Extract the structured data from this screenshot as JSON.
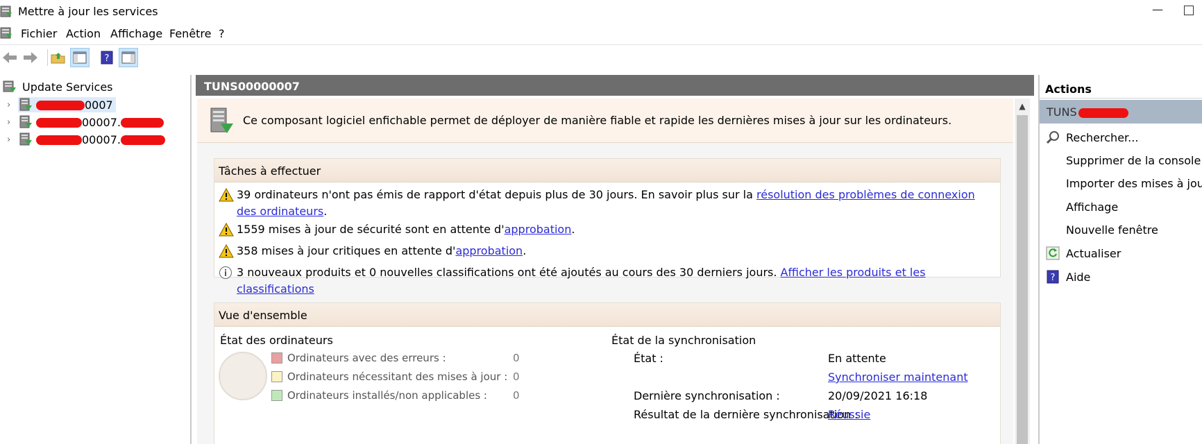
{
  "window": {
    "title": "Mettre à jour les services",
    "minimize": "—"
  },
  "menu": {
    "items": [
      "Fichier",
      "Action",
      "Affichage",
      "Fenêtre",
      "?"
    ]
  },
  "tree": {
    "root": "Update Services",
    "nodes": [
      {
        "label": "0007"
      },
      {
        "label": "00007."
      },
      {
        "label": "00007."
      }
    ]
  },
  "center": {
    "header": "TUNS00000007",
    "intro": "Ce composant logiciel enfichable permet de déployer de manière fiable et rapide les dernières mises à jour sur les ordinateurs.",
    "tasks_title": "Tâches à effectuer",
    "tasks": [
      {
        "icon": "warning-icon",
        "text": "39 ordinateurs n'ont pas émis de rapport d'état depuis plus de 30 jours. En savoir plus sur la ",
        "link": "résolution des problèmes de connexion des ordinateurs",
        "after": "."
      },
      {
        "icon": "warning-icon",
        "text": "1559 mises à jour de sécurité sont en attente d'",
        "link": "approbation",
        "after": "."
      },
      {
        "icon": "warning-icon",
        "text": "358 mises à jour critiques en attente d'",
        "link": "approbation",
        "after": "."
      },
      {
        "icon": "info-icon",
        "text": "3 nouveaux produits et 0 nouvelles classifications ont été ajoutés au cours des 30 derniers jours. ",
        "link": "Afficher les produits et les classifications",
        "after": ""
      }
    ],
    "overview_title": "Vue d'ensemble",
    "computers_title": "État des ordinateurs",
    "computer_stats": [
      {
        "label": "Ordinateurs avec des erreurs :",
        "count": "0",
        "color": "#e9a0a0"
      },
      {
        "label": "Ordinateurs nécessitant des mises à jour :",
        "count": "0",
        "color": "#fbf3c4"
      },
      {
        "label": "Ordinateurs installés/non applicables :",
        "count": "0",
        "color": "#bfe8b9"
      }
    ],
    "sync_title": "État de la synchronisation",
    "sync": {
      "state_label": "État :",
      "state_value": "En attente",
      "sync_now": "Synchroniser maintenant",
      "last_label": "Dernière synchronisation :",
      "last_value": "20/09/2021 16:18",
      "result_label": "Résultat de la dernière synchronisation :",
      "result_value": "Réussie"
    }
  },
  "actions": {
    "title": "Actions",
    "selected": "TUNS",
    "items": [
      {
        "label": "Rechercher...",
        "icon": "search-icon"
      },
      {
        "label": "Supprimer de la console",
        "icon": ""
      },
      {
        "label": "Importer des mises à jour",
        "icon": ""
      },
      {
        "label": "Affichage",
        "icon": ""
      },
      {
        "label": "Nouvelle fenêtre",
        "icon": ""
      },
      {
        "label": "Actualiser",
        "icon": "refresh-icon"
      },
      {
        "label": "Aide",
        "icon": "help-icon"
      }
    ]
  }
}
